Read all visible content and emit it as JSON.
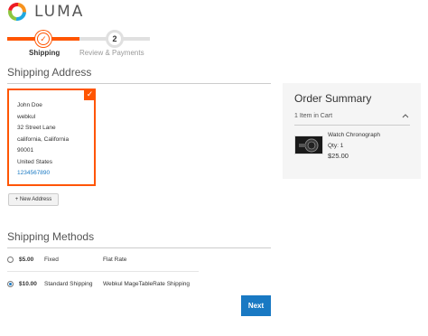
{
  "brand": {
    "name": "LUMA"
  },
  "progress": {
    "steps": [
      {
        "number": "✓",
        "label": "Shipping"
      },
      {
        "number": "2",
        "label": "Review & Payments"
      }
    ]
  },
  "shipping_address": {
    "title": "Shipping Address",
    "lines": [
      "John Doe",
      "webkul",
      "32 Street Lane",
      "california, California",
      "90001",
      "United States"
    ],
    "phone": "1234567890",
    "new_address_label": "+ New Address"
  },
  "shipping_methods": {
    "title": "Shipping Methods",
    "rows": [
      {
        "price": "$5.00",
        "method": "Fixed",
        "carrier": "Flat Rate",
        "selected": false
      },
      {
        "price": "$10.00",
        "method": "Standard Shipping",
        "carrier": "Webkul MageTableRate Shipping",
        "selected": true
      }
    ],
    "next_label": "Next"
  },
  "order_summary": {
    "title": "Order Summary",
    "items_in_cart": "1 Item in Cart",
    "product": {
      "name": "Watch Chronograph",
      "qty": "Qty: 1",
      "price": "$25.00"
    }
  },
  "colors": {
    "accent": "#ff5501",
    "link": "#1979c3",
    "button": "#1979c3"
  },
  "icons": {
    "logo": "luma-logo-icon",
    "check": "checkmark-icon",
    "chevron": "chevron-up-icon"
  }
}
